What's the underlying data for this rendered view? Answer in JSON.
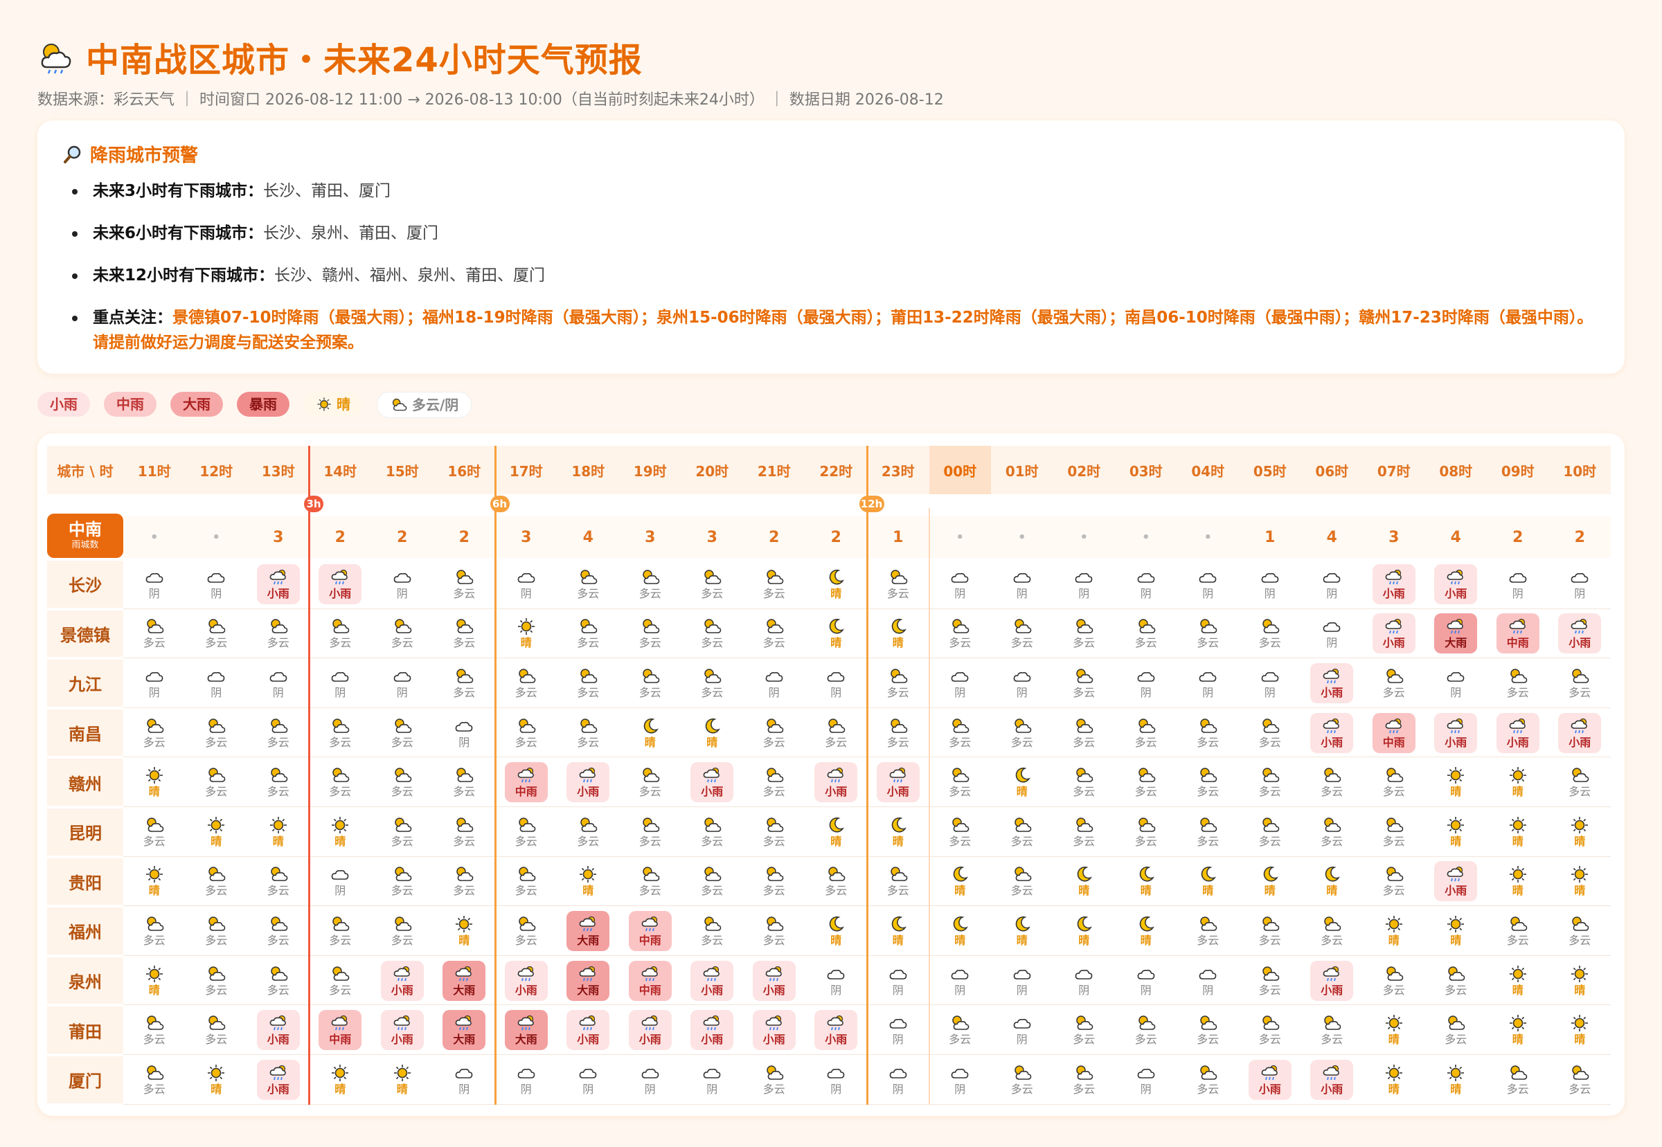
{
  "header": {
    "title": "中南战区城市・未来24小时天气预报",
    "subtitle": "数据来源：彩云天气 ｜ 时间窗口 2026-08-12 11:00 → 2026-08-13 10:00（自当前时刻起未来24小时） ｜ 数据日期 2026-08-12",
    "title_icon": "sun-cloud-rain-icon"
  },
  "alert": {
    "title": "降雨城市预警",
    "title_icon": "search-icon",
    "items": [
      {
        "label": "未来3小时有下雨城市：",
        "text": "长沙、莆田、厦门"
      },
      {
        "label": "未来6小时有下雨城市：",
        "text": "长沙、泉州、莆田、厦门"
      },
      {
        "label": "未来12小时有下雨城市：",
        "text": "长沙、赣州、福州、泉州、莆田、厦门"
      },
      {
        "label": "重点关注：",
        "text": "景德镇07-10时降雨（最强大雨）；福州18-19时降雨（最强大雨）；泉州15-06时降雨（最强大雨）；莆田13-22时降雨（最强大雨）；南昌06-10时降雨（最强中雨）；赣州17-23时降雨（最强中雨）。请提前做好运力调度与配送安全预案。"
      }
    ]
  },
  "legend": [
    {
      "label": "小雨",
      "cls": "l1"
    },
    {
      "label": "中雨",
      "cls": "l2"
    },
    {
      "label": "大雨",
      "cls": "l3"
    },
    {
      "label": "暴雨",
      "cls": "l4"
    },
    {
      "label": "晴",
      "cls": "sun",
      "icon": "sun-icon"
    },
    {
      "label": "多云/阴",
      "cls": "cloud",
      "icon": "cloud-icon"
    }
  ],
  "table": {
    "corner": "城市 \\ 时",
    "hours": [
      "11时",
      "12时",
      "13时",
      "14时",
      "15时",
      "16时",
      "17时",
      "18时",
      "19时",
      "20时",
      "21时",
      "22时",
      "23时",
      "00时",
      "01时",
      "02时",
      "03时",
      "04时",
      "05时",
      "06时",
      "07时",
      "08时",
      "09时",
      "10时"
    ],
    "now_index": 13,
    "markers": [
      {
        "label": "3h",
        "after": 2,
        "color": "red"
      },
      {
        "label": "6h",
        "after": 5,
        "color": "orange"
      },
      {
        "label": "12h",
        "after": 11,
        "color": "orange"
      }
    ],
    "summary_label": "中南",
    "summary_sub": "雨城数",
    "summary": [
      "•",
      "•",
      "3",
      "2",
      "2",
      "2",
      "3",
      "4",
      "3",
      "3",
      "2",
      "2",
      "1",
      "•",
      "•",
      "•",
      "•",
      "•",
      "1",
      "4",
      "3",
      "4",
      "2",
      "2"
    ],
    "cities": [
      "长沙",
      "景德镇",
      "九江",
      "南昌",
      "赣州",
      "昆明",
      "贵阳",
      "福州",
      "泉州",
      "莆田",
      "厦门"
    ],
    "grid": [
      [
        "阴",
        "阴",
        "小雨",
        "小雨",
        "阴",
        "多云",
        "阴",
        "多云",
        "多云",
        "多云",
        "多云",
        "晴",
        "多云",
        "阴",
        "阴",
        "阴",
        "阴",
        "阴",
        "阴",
        "阴",
        "小雨",
        "小雨",
        "阴",
        "阴"
      ],
      [
        "多云",
        "多云",
        "多云",
        "多云",
        "多云",
        "多云",
        "晴",
        "多云",
        "多云",
        "多云",
        "多云",
        "晴",
        "晴",
        "多云",
        "多云",
        "多云",
        "多云",
        "多云",
        "多云",
        "阴",
        "小雨",
        "大雨",
        "中雨",
        "小雨"
      ],
      [
        "阴",
        "阴",
        "阴",
        "阴",
        "阴",
        "多云",
        "多云",
        "多云",
        "多云",
        "多云",
        "阴",
        "阴",
        "多云",
        "阴",
        "阴",
        "多云",
        "阴",
        "阴",
        "阴",
        "小雨",
        "多云",
        "阴",
        "多云",
        "多云"
      ],
      [
        "多云",
        "多云",
        "多云",
        "多云",
        "多云",
        "阴",
        "多云",
        "多云",
        "晴",
        "晴",
        "多云",
        "多云",
        "多云",
        "多云",
        "多云",
        "多云",
        "多云",
        "多云",
        "多云",
        "小雨",
        "中雨",
        "小雨",
        "小雨",
        "小雨"
      ],
      [
        "晴",
        "多云",
        "多云",
        "多云",
        "多云",
        "多云",
        "中雨",
        "小雨",
        "多云",
        "小雨",
        "多云",
        "小雨",
        "小雨",
        "多云",
        "晴",
        "多云",
        "多云",
        "多云",
        "多云",
        "多云",
        "多云",
        "晴",
        "晴",
        "多云"
      ],
      [
        "多云",
        "晴",
        "晴",
        "晴",
        "多云",
        "多云",
        "多云",
        "多云",
        "多云",
        "多云",
        "多云",
        "晴",
        "晴",
        "多云",
        "多云",
        "多云",
        "多云",
        "多云",
        "多云",
        "多云",
        "多云",
        "晴",
        "晴",
        "晴"
      ],
      [
        "晴",
        "多云",
        "多云",
        "阴",
        "多云",
        "多云",
        "多云",
        "晴",
        "多云",
        "多云",
        "多云",
        "多云",
        "多云",
        "晴",
        "多云",
        "晴",
        "晴",
        "晴",
        "晴",
        "晴",
        "多云",
        "小雨",
        "晴",
        "晴"
      ],
      [
        "多云",
        "多云",
        "多云",
        "多云",
        "多云",
        "晴",
        "多云",
        "大雨",
        "中雨",
        "多云",
        "多云",
        "晴",
        "晴",
        "晴",
        "晴",
        "晴",
        "晴",
        "多云",
        "多云",
        "多云",
        "晴",
        "晴",
        "多云",
        "多云"
      ],
      [
        "晴",
        "多云",
        "多云",
        "多云",
        "小雨",
        "大雨",
        "小雨",
        "大雨",
        "中雨",
        "小雨",
        "小雨",
        "阴",
        "阴",
        "阴",
        "阴",
        "阴",
        "阴",
        "阴",
        "多云",
        "小雨",
        "多云",
        "多云",
        "晴",
        "晴"
      ],
      [
        "多云",
        "多云",
        "小雨",
        "中雨",
        "小雨",
        "大雨",
        "大雨",
        "小雨",
        "小雨",
        "小雨",
        "小雨",
        "小雨",
        "阴",
        "多云",
        "阴",
        "多云",
        "多云",
        "多云",
        "多云",
        "多云",
        "晴",
        "多云",
        "晴",
        "晴"
      ],
      [
        "多云",
        "晴",
        "小雨",
        "晴",
        "晴",
        "阴",
        "阴",
        "阴",
        "阴",
        "阴",
        "多云",
        "阴",
        "阴",
        "阴",
        "多云",
        "多云",
        "阴",
        "多云",
        "小雨",
        "小雨",
        "晴",
        "晴",
        "多云",
        "多云"
      ]
    ],
    "night_sun_cells": [
      [
        0,
        11
      ],
      [
        1,
        11
      ],
      [
        1,
        12
      ],
      [
        3,
        8
      ],
      [
        3,
        9
      ],
      [
        4,
        14
      ],
      [
        5,
        11
      ],
      [
        5,
        12
      ],
      [
        6,
        13
      ],
      [
        6,
        15
      ],
      [
        6,
        16
      ],
      [
        6,
        17
      ],
      [
        6,
        18
      ],
      [
        6,
        19
      ],
      [
        7,
        11
      ],
      [
        7,
        12
      ],
      [
        7,
        13
      ],
      [
        7,
        14
      ],
      [
        7,
        15
      ],
      [
        7,
        16
      ]
    ]
  },
  "colors": {
    "accent": "#e86a00",
    "rain_light": "#fde3e3",
    "rain_mid": "#fbc4c4",
    "rain_heavy": "#f3a0a0",
    "sun": "#f6b800"
  }
}
